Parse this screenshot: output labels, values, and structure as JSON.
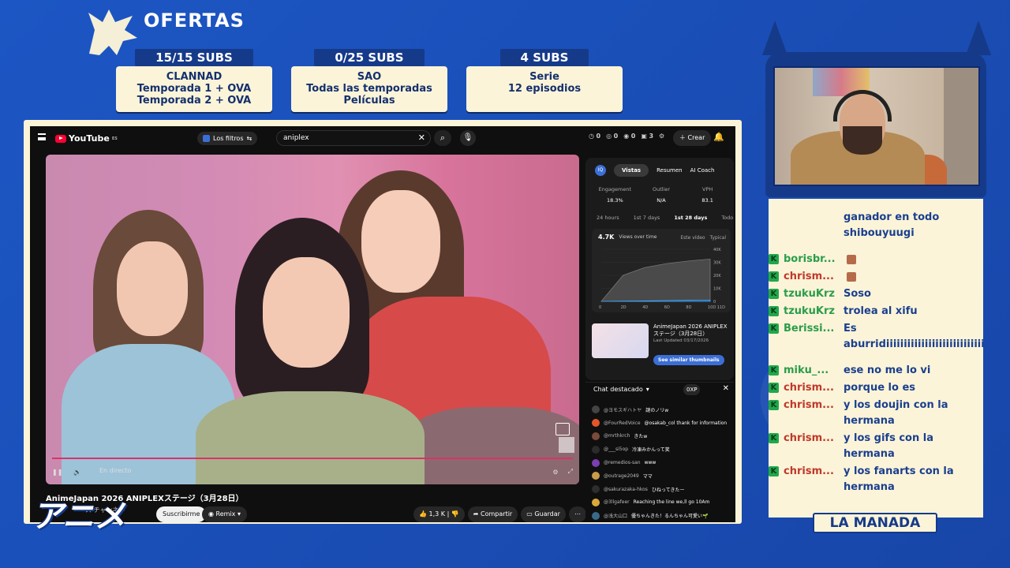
{
  "overlay": {
    "brand": "OFERTAS",
    "offers": [
      {
        "tag": "15/15 SUBS",
        "lines": [
          "CLANNAD",
          "Temporada 1 + OVA",
          "Temporada 2 + OVA"
        ]
      },
      {
        "tag": "0/25 SUBS",
        "lines": [
          "SAO",
          "Todas las temporadas",
          "Películas"
        ]
      },
      {
        "tag": "4 SUBS",
        "lines": [
          "Serie",
          "12 episodios"
        ]
      }
    ],
    "logo_text": "アニメ",
    "team_label": "LA MANADA"
  },
  "youtube": {
    "logo": "YouTube",
    "region": "ES",
    "filters_label": "Los filtros",
    "search_value": "aniplex",
    "counters": [
      "0",
      "0",
      "0",
      "3"
    ],
    "create_label": "Crear",
    "video": {
      "status": "En directo",
      "title": "AnimeJapan 2026 ANIPLEXステージ（3月28日）",
      "channel": "ス チャンネル",
      "subscribe_label": "Suscribirme",
      "remix_label": "Remix",
      "likes": "1,3 K",
      "share_label": "Compartir",
      "save_label": "Guardar"
    },
    "panel": {
      "tabs": [
        "Vistas",
        "Resumen",
        "AI Coach"
      ],
      "metrics": [
        {
          "label": "Engagement",
          "value": "18.3%"
        },
        {
          "label": "Outlier",
          "value": "N/A"
        },
        {
          "label": "VPH",
          "value": "83.1"
        }
      ],
      "ranges": [
        "24 hours",
        "1st 7 days",
        "1st 28 days",
        "Todo"
      ],
      "active_range": "1st 28 days",
      "views": "4.7K",
      "views_label": "Views over time",
      "legend": [
        "Este vídeo",
        "Typical"
      ],
      "thumb_title": "AnimeJapan 2026 ANIPLEXステージ（3月28日）",
      "thumb_date": "Last Updated 03/17/2026",
      "similar_label": "See similar thumbnails"
    },
    "chat": {
      "header": "Chat destacado",
      "xp": "0XP",
      "messages": [
        {
          "user": "@ヨモスギハトヤ",
          "text": "謎のノリw",
          "color": "#444"
        },
        {
          "user": "@FourRedVoice",
          "text": "@osakab_col thank for information",
          "color": "#e2572a"
        },
        {
          "user": "@mrthkrch",
          "text": "きたw",
          "color": "#7a4a3a"
        },
        {
          "user": "@___si5op",
          "text": "冷凍みかんって笑",
          "color": "#2b2b2b"
        },
        {
          "user": "@remedios-san",
          "text": "www",
          "color": "#7a3fb0"
        },
        {
          "user": "@outrage2049",
          "text": "ママ",
          "color": "#c99b4a"
        },
        {
          "user": "@sakurazaka-hkos",
          "text": "ひねってきたー",
          "color": "#2d2d2d"
        },
        {
          "user": "@3llgafeer",
          "text": "Reaching the line we,ll go 10Am",
          "color": "#d9a93a"
        },
        {
          "user": "@浅大山口",
          "text": "優ちゃんきた！るんちゃん可愛い🌱",
          "color": "#3a6a8a"
        }
      ]
    }
  },
  "chart_data": {
    "type": "area",
    "title": "Views over time",
    "x": [
      0,
      2,
      4,
      6,
      8,
      10
    ],
    "x_tick_labels": [
      "0",
      "2D",
      "4D",
      "6D",
      "8D",
      "10D 11D"
    ],
    "series": [
      {
        "name": "Este vídeo",
        "values": [
          0,
          200,
          400,
          600,
          800,
          1000
        ]
      },
      {
        "name": "Typical",
        "values": [
          0,
          20000,
          26000,
          29000,
          31000,
          32500
        ]
      }
    ],
    "ylim": [
      0,
      40000
    ],
    "y_tick_labels": [
      "0",
      "10K",
      "20K",
      "30K",
      "40K"
    ]
  },
  "twitch_chat": [
    {
      "user": "",
      "text": "ganador en todo shibouyuugi",
      "color": "#1b3f8f"
    },
    {
      "user": "borisbr...",
      "text": "",
      "emote": true,
      "color": "#2a9d4a"
    },
    {
      "user": "chrism...",
      "text": "",
      "emote": true,
      "color": "#c0392b"
    },
    {
      "user": "tzukuKrz",
      "text": "Soso",
      "color": "#2a9d4a"
    },
    {
      "user": "tzukuKrz",
      "text": "trolea al xifu",
      "color": "#2a9d4a"
    },
    {
      "user": "Berissi...",
      "text": "Es aburridiiiiiiiiiiiiiiiiiiiiiiiiiiiisimo",
      "color": "#2a9d4a"
    },
    {
      "user": "miku_...",
      "text": "ese no me lo vi",
      "color": "#2a9d4a"
    },
    {
      "user": "chrism...",
      "text": "porque lo es",
      "color": "#c0392b"
    },
    {
      "user": "chrism...",
      "text": "y los doujin con la hermana",
      "color": "#c0392b"
    },
    {
      "user": "chrism...",
      "text": "y los gifs con la hermana",
      "color": "#c0392b"
    },
    {
      "user": "chrism...",
      "text": "y los fanarts con la hermana",
      "color": "#c0392b"
    }
  ]
}
